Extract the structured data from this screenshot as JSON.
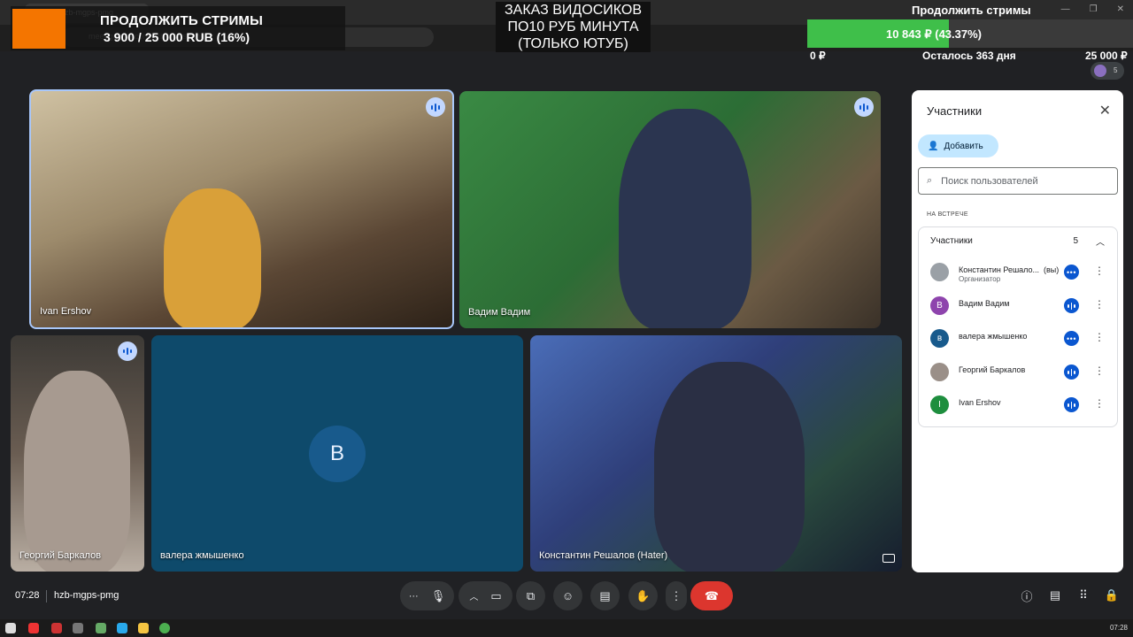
{
  "browser": {
    "tab_title": "hzb-mgps-pmg",
    "url": "meet.google.com/hzb-mgps-pmg"
  },
  "overlays": {
    "donate_title": "ПРОДОЛЖИТЬ СТРИМЫ",
    "donate_sum": "3 900 / 25 000 RUB (16%)",
    "order_text": "ЗАКАЗ ВИДОСИКОВ ПО10 РУБ МИНУТА (ТОЛЬКО ЮТУБ)",
    "goal_title": "Продолжить стримы",
    "goal_value": "10 843 ₽ (43.37%)",
    "goal_progress": 0.4337,
    "goal_min": "0 ₽",
    "goal_left": "Осталось 363 дня",
    "goal_max": "25 000 ₽",
    "header_participants_count": "5"
  },
  "tiles": [
    {
      "name": "Ivan Ershov",
      "speaking": true
    },
    {
      "name": "Вадим Вадим",
      "speaking": true
    },
    {
      "name": "Георгий Баркалов",
      "speaking": false
    },
    {
      "name": "валера жмышенко",
      "avatar_letter": "В"
    },
    {
      "name": "Константин Решалов (Hater)"
    }
  ],
  "panel": {
    "title": "Участники",
    "add_label": "Добавить",
    "search_placeholder": "Поиск пользователей",
    "section_caption": "НА ВСТРЕЧЕ",
    "group_label": "Участники",
    "group_count": "5",
    "participants": [
      {
        "name": "Константин Решало...",
        "you": "(вы)",
        "role": "Организатор",
        "avatar_letter": "",
        "avatar_color": "#9aa0a6"
      },
      {
        "name": "Вадим Вадим",
        "avatar_letter": "В",
        "avatar_color": "#8e44ad"
      },
      {
        "name": "валера жмышенко",
        "avatar_letter": "в",
        "avatar_color": "#185a8c"
      },
      {
        "name": "Георгий Баркалов",
        "avatar_letter": "",
        "avatar_color": "#9a8f88"
      },
      {
        "name": "Ivan Ershov",
        "avatar_letter": "I",
        "avatar_color": "#1e8e3e"
      }
    ]
  },
  "bottom": {
    "clock": "07:28",
    "meeting_code": "hzb-mgps-pmg"
  },
  "taskbar": {
    "clock": "07:28"
  },
  "colors": {
    "accent": "#0b57d0",
    "end_call": "#dc362e",
    "goal_fill": "#3fbf4a"
  }
}
